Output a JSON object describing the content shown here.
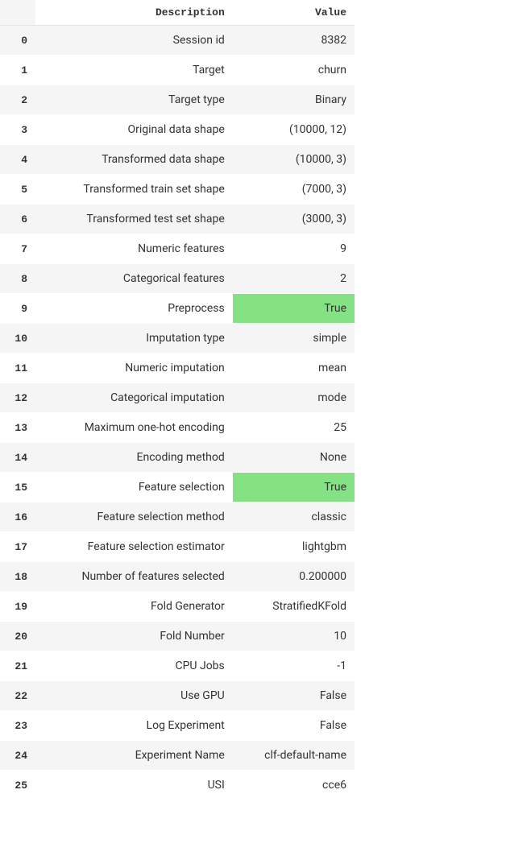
{
  "columns": {
    "index": "",
    "description": "Description",
    "value": "Value"
  },
  "rows": [
    {
      "index": "0",
      "description": "Session id",
      "value": "8382",
      "highlight": false
    },
    {
      "index": "1",
      "description": "Target",
      "value": "churn",
      "highlight": false
    },
    {
      "index": "2",
      "description": "Target type",
      "value": "Binary",
      "highlight": false
    },
    {
      "index": "3",
      "description": "Original data shape",
      "value": "(10000, 12)",
      "highlight": false
    },
    {
      "index": "4",
      "description": "Transformed data shape",
      "value": "(10000, 3)",
      "highlight": false
    },
    {
      "index": "5",
      "description": "Transformed train set shape",
      "value": "(7000, 3)",
      "highlight": false
    },
    {
      "index": "6",
      "description": "Transformed test set shape",
      "value": "(3000, 3)",
      "highlight": false
    },
    {
      "index": "7",
      "description": "Numeric features",
      "value": "9",
      "highlight": false
    },
    {
      "index": "8",
      "description": "Categorical features",
      "value": "2",
      "highlight": false
    },
    {
      "index": "9",
      "description": "Preprocess",
      "value": "True",
      "highlight": true
    },
    {
      "index": "10",
      "description": "Imputation type",
      "value": "simple",
      "highlight": false
    },
    {
      "index": "11",
      "description": "Numeric imputation",
      "value": "mean",
      "highlight": false
    },
    {
      "index": "12",
      "description": "Categorical imputation",
      "value": "mode",
      "highlight": false
    },
    {
      "index": "13",
      "description": "Maximum one-hot encoding",
      "value": "25",
      "highlight": false
    },
    {
      "index": "14",
      "description": "Encoding method",
      "value": "None",
      "highlight": false
    },
    {
      "index": "15",
      "description": "Feature selection",
      "value": "True",
      "highlight": true
    },
    {
      "index": "16",
      "description": "Feature selection method",
      "value": "classic",
      "highlight": false
    },
    {
      "index": "17",
      "description": "Feature selection estimator",
      "value": "lightgbm",
      "highlight": false
    },
    {
      "index": "18",
      "description": "Number of features selected",
      "value": "0.200000",
      "highlight": false
    },
    {
      "index": "19",
      "description": "Fold Generator",
      "value": "StratifiedKFold",
      "highlight": false
    },
    {
      "index": "20",
      "description": "Fold Number",
      "value": "10",
      "highlight": false
    },
    {
      "index": "21",
      "description": "CPU Jobs",
      "value": "-1",
      "highlight": false
    },
    {
      "index": "22",
      "description": "Use GPU",
      "value": "False",
      "highlight": false
    },
    {
      "index": "23",
      "description": "Log Experiment",
      "value": "False",
      "highlight": false
    },
    {
      "index": "24",
      "description": "Experiment Name",
      "value": "clf-default-name",
      "highlight": false
    },
    {
      "index": "25",
      "description": "USI",
      "value": "cce6",
      "highlight": false
    }
  ]
}
